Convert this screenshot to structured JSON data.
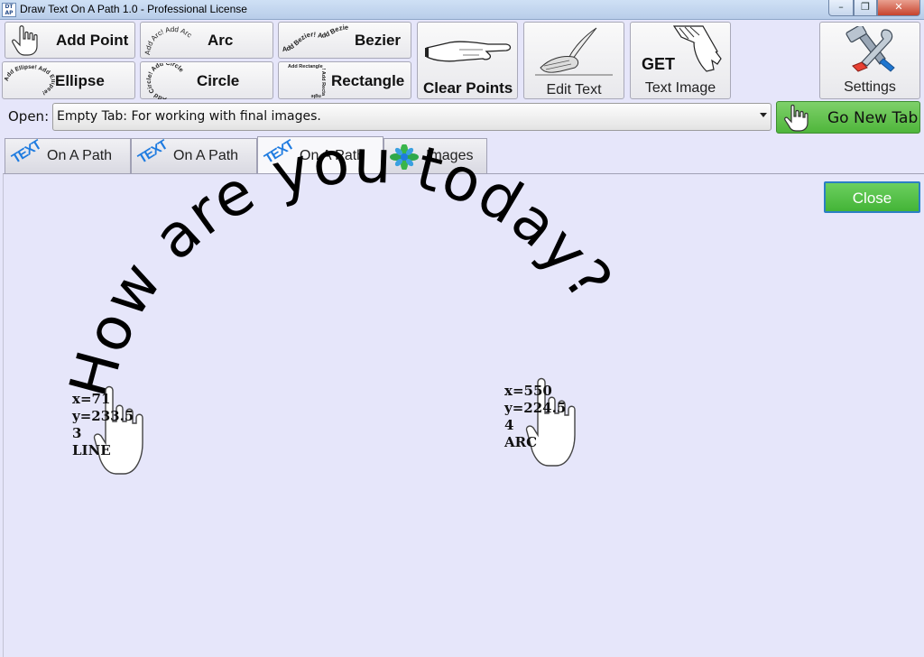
{
  "window": {
    "title": "Draw Text On A Path 1.0 - Professional License",
    "icon_text": "DT AP",
    "minimize_glyph": "–",
    "maximize_glyph": "❐",
    "close_glyph": "✕"
  },
  "toolbar": {
    "add_point": "Add Point",
    "arc": "Arc",
    "arc_icon_text": "Add Arc! Add Arc",
    "bezier": "Bezier",
    "bezier_icon_text": "Add Bezier! Add Bezier!",
    "ellipse": "Ellipse",
    "ellipse_icon_text": "Add Ellipse! Add Ellipse!",
    "circle": "Circle",
    "circle_icon_text": "Add Circle! Add Circle",
    "rectangle": "Rectangle",
    "rectangle_icon_text": "Add Rectangle! Add Rectangle",
    "clear_points": "Clear Points",
    "edit_text": "Edit Text",
    "get_label": "GET",
    "text_image": "Text Image",
    "settings": "Settings"
  },
  "open_row": {
    "label": "Open:",
    "selected": "Empty Tab: For working with final images.",
    "go_new_tab": "Go New Tab"
  },
  "tabs": [
    {
      "badge": "TEXT",
      "label": "On A Path"
    },
    {
      "badge": "TEXT",
      "label": "On A Path"
    },
    {
      "badge": "TEXT",
      "label": "On A Path"
    },
    {
      "label": "Images"
    }
  ],
  "canvas": {
    "close_label": "Close",
    "curved_text": "How are you today?",
    "points": [
      {
        "x_text": "x=71",
        "y_text": "y=233.5",
        "index": "3",
        "type": "LINE"
      },
      {
        "x_text": "x=550",
        "y_text": "y=224.5",
        "index": "4",
        "type": "ARC"
      }
    ]
  },
  "colors": {
    "background": "#e6e6fa",
    "go_button": "#5cc249",
    "close_button": "#57c24a",
    "text_badge": "#1e7be0"
  }
}
